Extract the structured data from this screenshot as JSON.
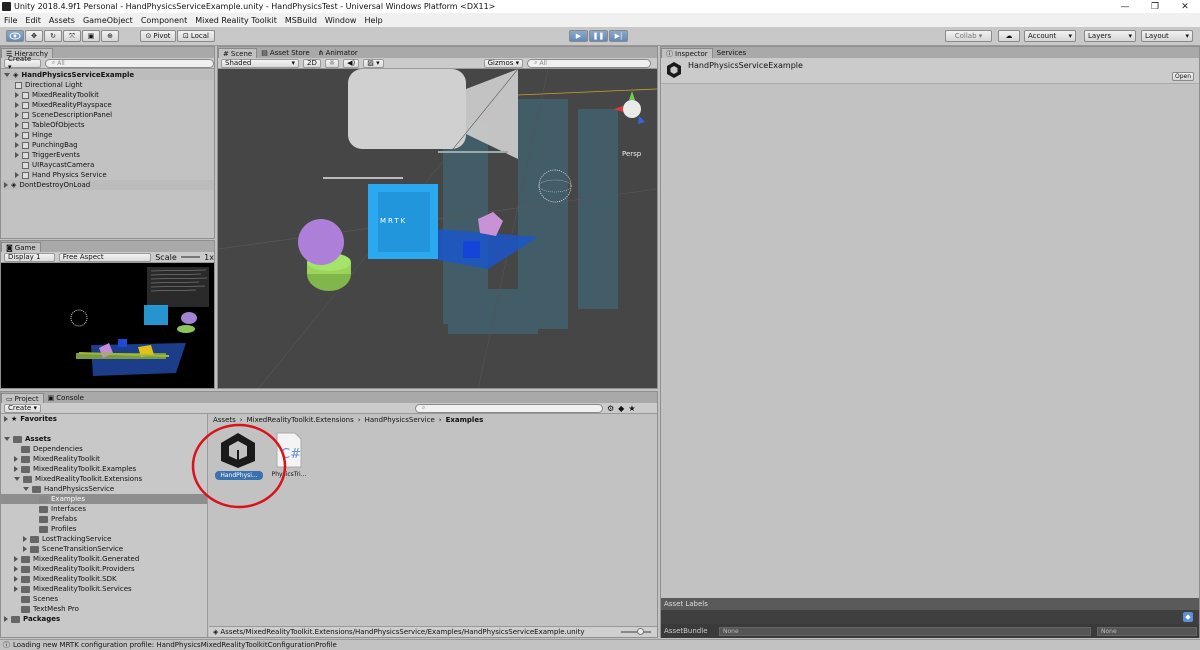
{
  "window": {
    "title": "Unity 2018.4.9f1 Personal - HandPhysicsServiceExample.unity - HandPhysicsTest - Universal Windows Platform <DX11>",
    "controls": [
      "—",
      "❐",
      "✕"
    ]
  },
  "menu": [
    "File",
    "Edit",
    "Assets",
    "GameObject",
    "Component",
    "Mixed Reality Toolkit",
    "MSBuild",
    "Window",
    "Help"
  ],
  "toolbar": {
    "pivot": "Pivot",
    "local": "Local",
    "collab": "Collab ▾",
    "account": "Account",
    "layers": "Layers",
    "layout": "Layout"
  },
  "hierarchy": {
    "tab": "Hierarchy",
    "create": "Create ▾",
    "search_placeholder": "All",
    "scene": "HandPhysicsServiceExample",
    "items": [
      "Directional Light",
      "MixedRealityToolkit",
      "MixedRealityPlayspace",
      "SceneDescriptionPanel",
      "TableOfObjects",
      "Hinge",
      "PunchingBag",
      "TriggerEvents",
      "UIRaycastCamera",
      "Hand Physics Service"
    ],
    "dontdestroy": "DontDestroyOnLoad"
  },
  "scene": {
    "tabs": [
      "Scene",
      "Asset Store",
      "Animator"
    ],
    "shading": "Shaded",
    "mode_2d": "2D",
    "gizmos": "Gizmos ▾",
    "search_placeholder": "All",
    "persp": "Persp",
    "panel_text": "MRTK"
  },
  "game": {
    "tab": "Game",
    "display": "Display 1",
    "aspect": "Free Aspect",
    "scale_label": "Scale",
    "scale_value": "1x"
  },
  "project": {
    "tabs": [
      "Project",
      "Console"
    ],
    "create": "Create ▾",
    "favorites": "Favorites",
    "assets": "Assets",
    "tree": [
      {
        "label": "Dependencies",
        "level": 1
      },
      {
        "label": "MixedRealityToolkit",
        "level": 1
      },
      {
        "label": "MixedRealityToolkit.Examples",
        "level": 1
      },
      {
        "label": "MixedRealityToolkit.Extensions",
        "level": 1,
        "open": true
      },
      {
        "label": "HandPhysicsService",
        "level": 2,
        "open": true
      },
      {
        "label": "Examples",
        "level": 3,
        "selected": true
      },
      {
        "label": "Interfaces",
        "level": 3
      },
      {
        "label": "Prefabs",
        "level": 3
      },
      {
        "label": "Profiles",
        "level": 3
      },
      {
        "label": "LostTrackingService",
        "level": 2
      },
      {
        "label": "SceneTransitionService",
        "level": 2
      },
      {
        "label": "MixedRealityToolkit.Generated",
        "level": 1
      },
      {
        "label": "MixedRealityToolkit.Providers",
        "level": 1
      },
      {
        "label": "MixedRealityToolkit.SDK",
        "level": 1
      },
      {
        "label": "MixedRealityToolkit.Services",
        "level": 1
      },
      {
        "label": "Scenes",
        "level": 1
      },
      {
        "label": "TextMesh Pro",
        "level": 1
      }
    ],
    "packages": "Packages",
    "breadcrumb": [
      "Assets",
      "MixedRealityToolkit.Extensions",
      "HandPhysicsService",
      "Examples"
    ],
    "files": [
      {
        "label": "HandPhysi...",
        "kind": "unity-scene"
      },
      {
        "label": "PhysicsTri...",
        "kind": "csharp"
      }
    ],
    "path": "Assets/MixedRealityToolkit.Extensions/HandPhysicsService/Examples/HandPhysicsServiceExample.unity"
  },
  "inspector": {
    "tabs": [
      "Inspector",
      "Services"
    ],
    "object": "HandPhysicsServiceExample",
    "open": "Open",
    "asset_labels": "Asset Labels",
    "asset_bundle": "AssetBundle",
    "bundle_value": "None",
    "variant_value": "None"
  },
  "status": "Loading new MRTK configuration profile: HandPhysicsMixedRealityToolkitConfigurationProfile",
  "colors": {
    "highlight_circle": "#d8131b",
    "selection": "#3a72b0",
    "play_active": "#6e94c5"
  }
}
